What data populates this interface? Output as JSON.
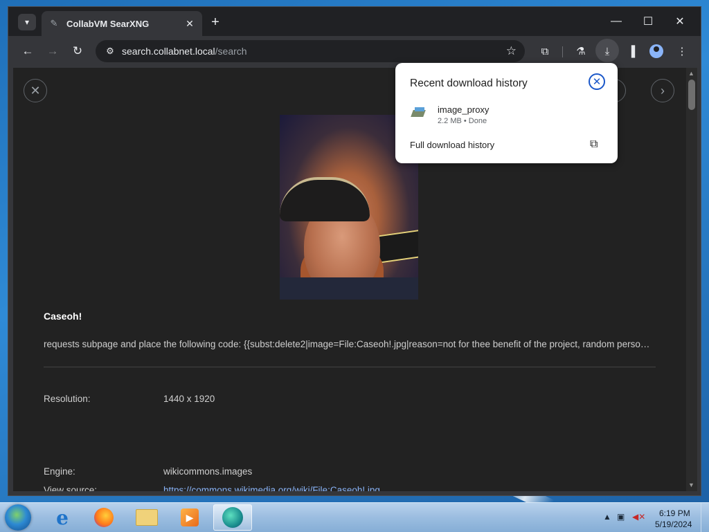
{
  "browser": {
    "tab_title": "CollabVM SearXNG",
    "url_host": "search.collabnet.local",
    "url_path": "/search"
  },
  "result": {
    "title": "Caseoh!",
    "description": "requests subpage and place the following code: {{subst:delete2|image=File:Caseoh!.jpg|reason=not for thee benefit of the project, random person and …",
    "resolution_label": "Resolution:",
    "resolution_value": "1440 x 1920",
    "engine_label": "Engine:",
    "engine_value": "wikicommons.images",
    "source_label": "View source:",
    "source_value": "https://commons.wikimedia.org/wiki/File:Caseoh!.jpg"
  },
  "downloads": {
    "title": "Recent download history",
    "file_name": "image_proxy",
    "file_meta": "2.2 MB • Done",
    "full_history_label": "Full download history"
  },
  "taskbar": {
    "time": "6:19 PM",
    "date": "5/19/2024"
  },
  "colors": {
    "link": "#8ab4f8",
    "page_bg": "#222222",
    "popup_close": "#1a57c9"
  }
}
